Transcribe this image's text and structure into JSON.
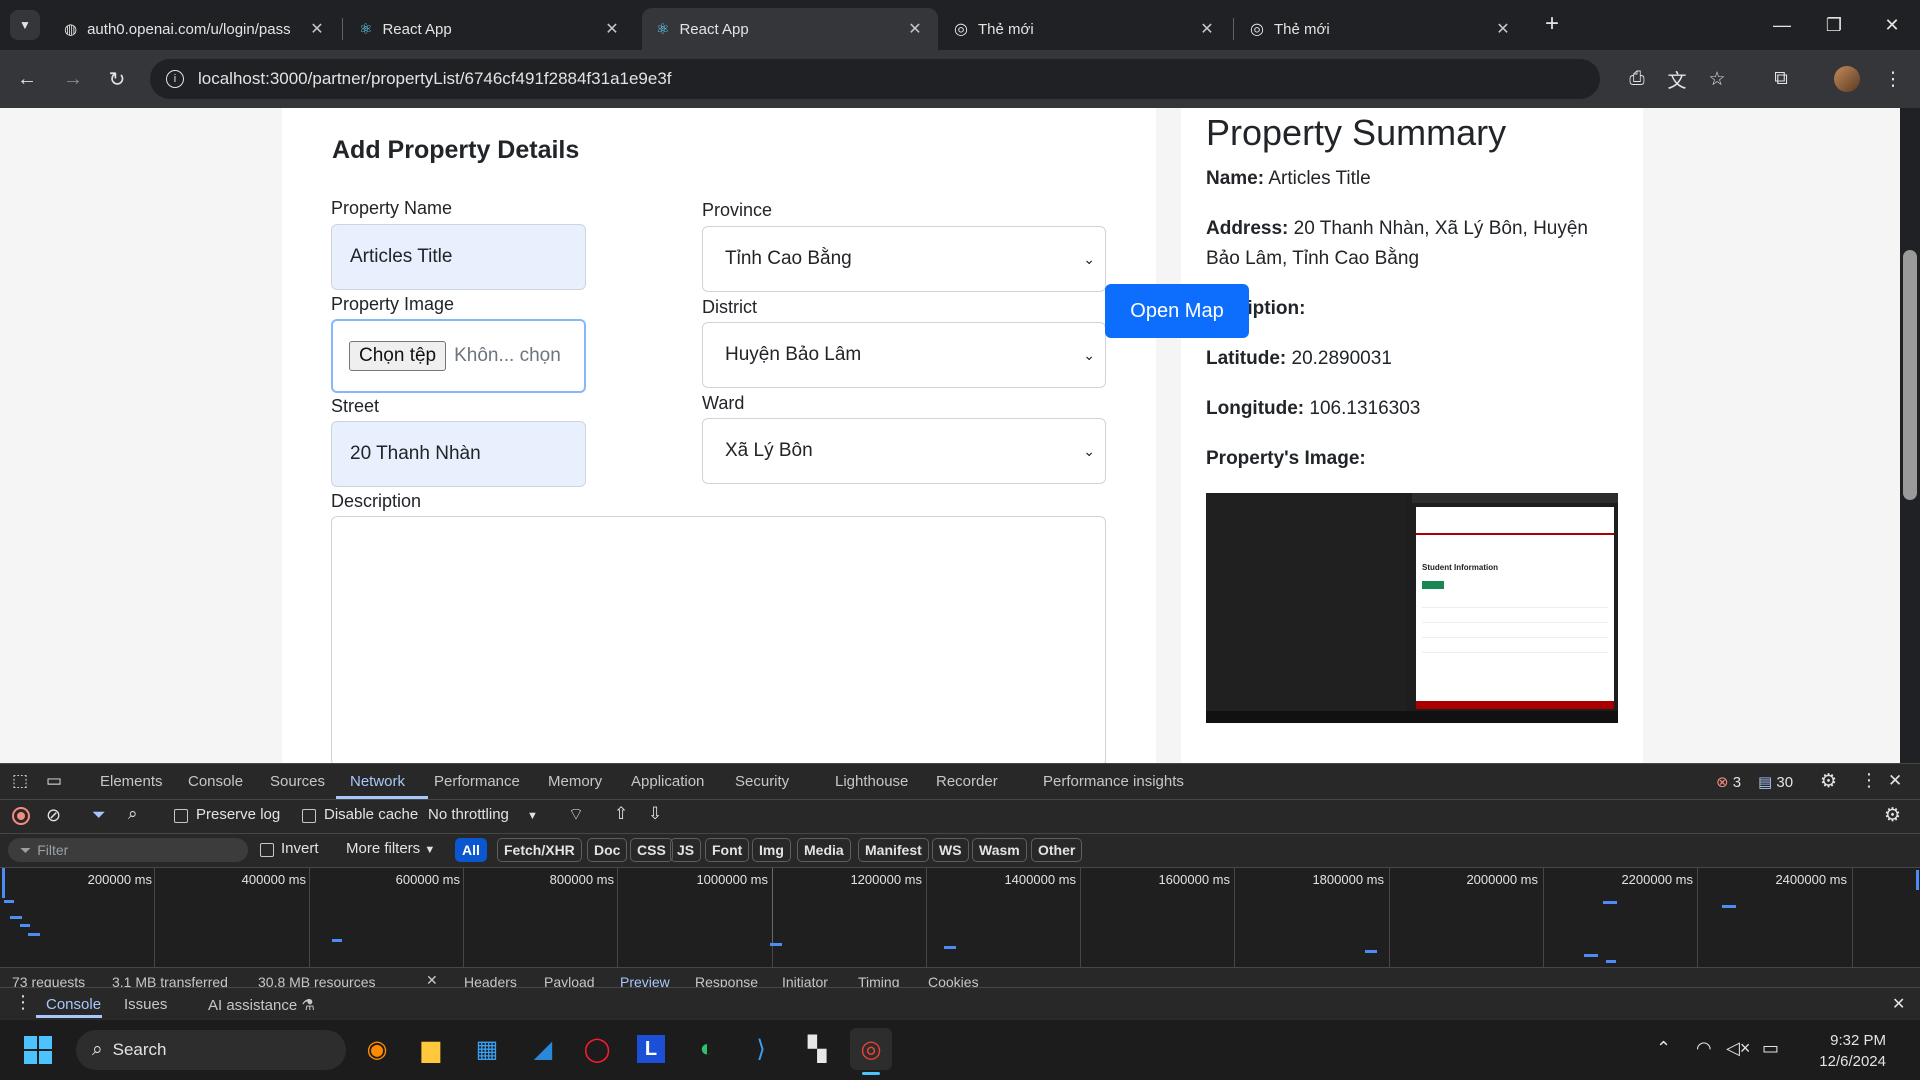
{
  "browser": {
    "tabs": [
      {
        "title": "auth0.openai.com/u/login/pass",
        "icon": "globe-icon",
        "active": false
      },
      {
        "title": "React App",
        "icon": "react-icon",
        "active": false
      },
      {
        "title": "React App",
        "icon": "react-icon",
        "active": true
      },
      {
        "title": "Thẻ mới",
        "icon": "chrome-icon",
        "active": false
      },
      {
        "title": "Thẻ mới",
        "icon": "chrome-icon",
        "active": false
      }
    ],
    "close_glyph": "✕",
    "new_tab_glyph": "+",
    "window": {
      "minimize": "—",
      "maximize": "❐",
      "close": "✕"
    },
    "nav": {
      "back": "←",
      "forward": "→",
      "reload": "↻"
    },
    "url": "localhost:3000/partner/propertyList/6746cf491f2884f31a1e9e3f",
    "menu_glyph": "⋮"
  },
  "form": {
    "title": "Add Property Details",
    "property_name_label": "Property Name",
    "property_name_value": "Articles Title",
    "property_image_label": "Property Image",
    "file_button": "Chọn tệp",
    "file_status": "Khôn... chọn",
    "street_label": "Street",
    "street_value": "20 Thanh Nhàn",
    "description_label": "Description",
    "description_value": "",
    "province_label": "Province",
    "province_value": "Tỉnh Cao Bằng",
    "district_label": "District",
    "district_value": "Huyện Bảo Lâm",
    "ward_label": "Ward",
    "ward_value": "Xã Lý Bôn",
    "open_map": "Open Map"
  },
  "summary": {
    "title": "Property Summary",
    "name_label": "Name:",
    "name_value": "Articles Title",
    "address_label": "Address:",
    "address_value": "20 Thanh Nhàn, Xã Lý Bôn, Huyện Bảo Lâm, Tỉnh Cao Bằng",
    "description_label": "ription:",
    "latitude_label": "Latitude:",
    "latitude_value": "20.2890031",
    "longitude_label": "Longitude:",
    "longitude_value": "106.1316303",
    "image_label": "Property's Image:",
    "image_inner_title": "Student Information"
  },
  "devtools": {
    "tabs": [
      "Elements",
      "Console",
      "Sources",
      "Network",
      "Performance",
      "Memory",
      "Application",
      "Security",
      "Lighthouse",
      "Recorder",
      "Performance insights"
    ],
    "active_tab": "Network",
    "errors": "3",
    "messages": "30",
    "preserve_log": "Preserve log",
    "disable_cache": "Disable cache",
    "throttling": "No throttling",
    "filter_placeholder": "Filter",
    "invert": "Invert",
    "more_filters": "More filters",
    "chips": [
      "All",
      "Fetch/XHR",
      "Doc",
      "CSS",
      "JS",
      "Font",
      "Img",
      "Media",
      "Manifest",
      "WS",
      "Wasm",
      "Other"
    ],
    "active_chip": "All",
    "timeline_labels": [
      "200000 ms",
      "400000 ms",
      "600000 ms",
      "800000 ms",
      "1000000 ms",
      "1200000 ms",
      "1400000 ms",
      "1600000 ms",
      "1800000 ms",
      "2000000 ms",
      "2200000 ms",
      "2400000 ms"
    ],
    "status": [
      "73 requests",
      "3.1 MB transferred",
      "30.8 MB resources"
    ],
    "detail_tabs": [
      "Headers",
      "Payload",
      "Preview",
      "Response",
      "Initiator",
      "Timing",
      "Cookies"
    ],
    "drawer_tabs": [
      "Console",
      "Issues",
      "AI assistance"
    ]
  },
  "taskbar": {
    "search_label": "Search",
    "time": "9:32 PM",
    "date": "12/6/2024"
  }
}
